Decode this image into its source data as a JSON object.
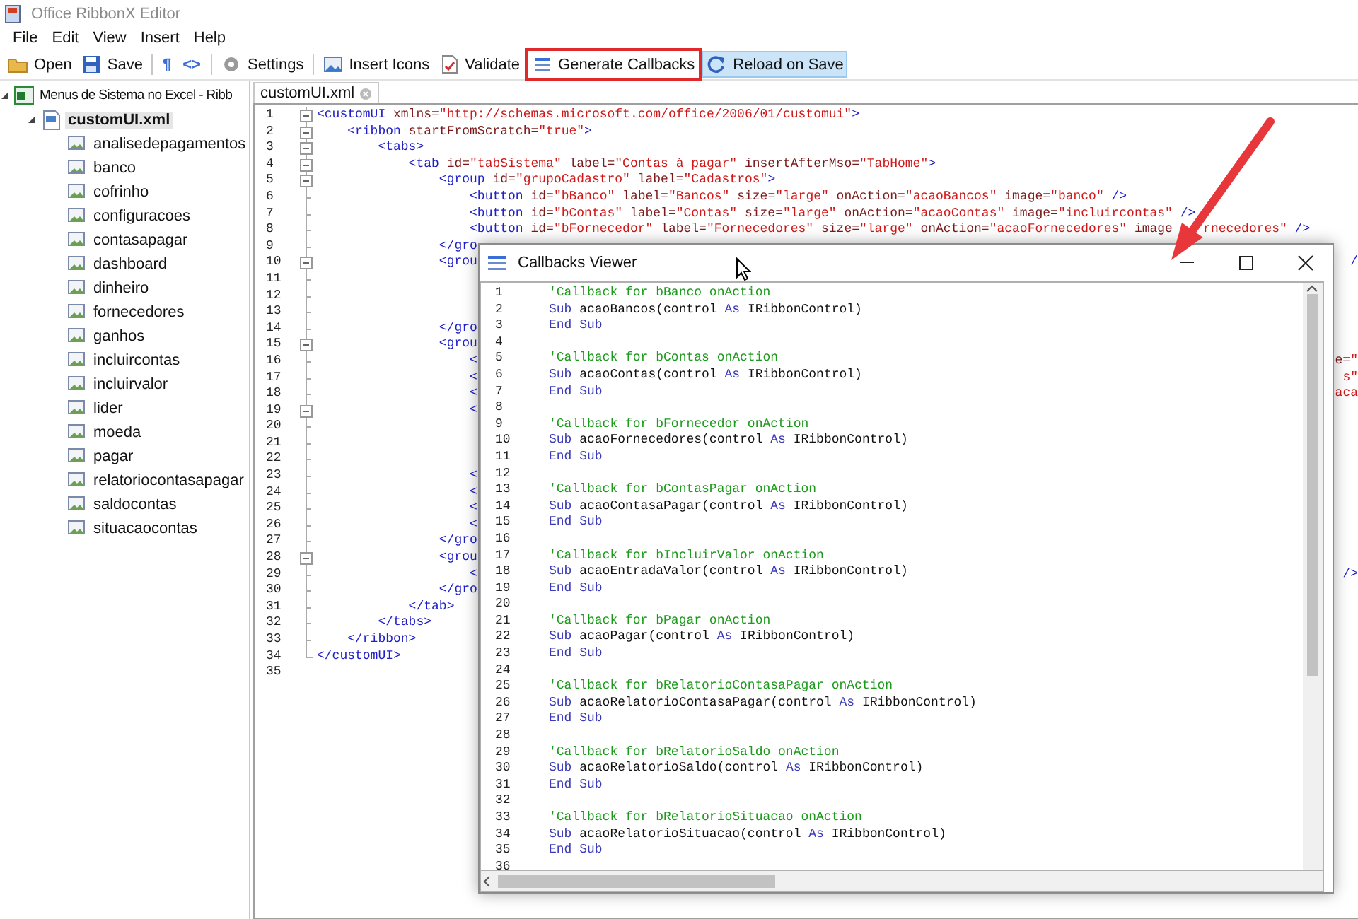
{
  "window": {
    "title": "Office RibbonX Editor"
  },
  "menu": [
    "File",
    "Edit",
    "View",
    "Insert",
    "Help"
  ],
  "toolbar": [
    {
      "kind": "button",
      "label": "Open",
      "checked": false,
      "highlighted": false
    },
    {
      "kind": "button",
      "label": "Save",
      "checked": false,
      "highlighted": false
    },
    {
      "kind": "separator"
    },
    {
      "kind": "glyph",
      "label": "¶"
    },
    {
      "kind": "glyph",
      "label": "<>"
    },
    {
      "kind": "separator"
    },
    {
      "kind": "button",
      "label": "Settings",
      "checked": false,
      "highlighted": false
    },
    {
      "kind": "separator"
    },
    {
      "kind": "button",
      "label": "Insert Icons",
      "checked": false,
      "highlighted": false
    },
    {
      "kind": "button",
      "label": "Validate",
      "checked": false,
      "highlighted": false
    },
    {
      "kind": "button",
      "label": "Generate Callbacks",
      "checked": false,
      "highlighted": true
    },
    {
      "kind": "button",
      "label": "Reload on Save",
      "checked": true,
      "highlighted": false
    }
  ],
  "tree": [
    {
      "label": "Menus de Sistema no Excel - Ribb",
      "expanded": true,
      "selected": false,
      "children": [
        {
          "label": "customUI.xml",
          "expanded": true,
          "selected": true,
          "children": [
            {
              "label": "analisedepagamentos",
              "selected": false
            },
            {
              "label": "banco",
              "selected": false
            },
            {
              "label": "cofrinho",
              "selected": false
            },
            {
              "label": "configuracoes",
              "selected": false
            },
            {
              "label": "contasapagar",
              "selected": false
            },
            {
              "label": "dashboard",
              "selected": false
            },
            {
              "label": "dinheiro",
              "selected": false
            },
            {
              "label": "fornecedores",
              "selected": false
            },
            {
              "label": "ganhos",
              "selected": false
            },
            {
              "label": "incluircontas",
              "selected": false
            },
            {
              "label": "incluirvalor",
              "selected": false
            },
            {
              "label": "lider",
              "selected": false
            },
            {
              "label": "moeda",
              "selected": false
            },
            {
              "label": "pagar",
              "selected": false
            },
            {
              "label": "relatoriocontasapagar",
              "selected": false
            },
            {
              "label": "saldocontas",
              "selected": false
            },
            {
              "label": "situacaocontas",
              "selected": false
            }
          ]
        }
      ]
    }
  ],
  "editor": {
    "tab": {
      "label": "customUI.xml",
      "selected": true
    },
    "lines": [
      {
        "number": "1",
        "kind": "toggle",
        "tokens": [
          {
            "kind": "tag",
            "text": "<customUI"
          },
          {
            "kind": "attr",
            "text": " xmlns="
          },
          {
            "kind": "value",
            "text": "\"http://schemas.microsoft.com/office/2006/01/customui\""
          },
          {
            "kind": "tag",
            "text": ">"
          }
        ]
      },
      {
        "number": "2",
        "kind": "toggle",
        "tokens": [
          {
            "kind": "tag",
            "text": "    <ribbon"
          },
          {
            "kind": "attr",
            "text": " startFromScratch="
          },
          {
            "kind": "value",
            "text": "\"true\""
          },
          {
            "kind": "tag",
            "text": ">"
          }
        ]
      },
      {
        "number": "3",
        "kind": "toggle",
        "tokens": [
          {
            "kind": "tag",
            "text": "        <tabs>"
          }
        ]
      },
      {
        "number": "4",
        "kind": "toggle",
        "tokens": [
          {
            "kind": "tag",
            "text": "            <tab"
          },
          {
            "kind": "attr",
            "text": " id="
          },
          {
            "kind": "value",
            "text": "\"tabSistema\""
          },
          {
            "kind": "attr",
            "text": " label="
          },
          {
            "kind": "value",
            "text": "\"Contas à pagar\""
          },
          {
            "kind": "attr",
            "text": " insertAfterMso="
          },
          {
            "kind": "value",
            "text": "\"TabHome\""
          },
          {
            "kind": "tag",
            "text": ">"
          }
        ]
      },
      {
        "number": "5",
        "kind": "toggle",
        "tokens": [
          {
            "kind": "tag",
            "text": "                <group"
          },
          {
            "kind": "attr",
            "text": " id="
          },
          {
            "kind": "value",
            "text": "\"grupoCadastro\""
          },
          {
            "kind": "attr",
            "text": " label="
          },
          {
            "kind": "value",
            "text": "\"Cadastros\""
          },
          {
            "kind": "tag",
            "text": ">"
          }
        ]
      },
      {
        "number": "6",
        "kind": "line",
        "tokens": [
          {
            "kind": "tag",
            "text": "                    <button"
          },
          {
            "kind": "attr",
            "text": " id="
          },
          {
            "kind": "value",
            "text": "\"bBanco\""
          },
          {
            "kind": "attr",
            "text": " label="
          },
          {
            "kind": "value",
            "text": "\"Bancos\""
          },
          {
            "kind": "attr",
            "text": " size="
          },
          {
            "kind": "value",
            "text": "\"large\""
          },
          {
            "kind": "attr",
            "text": " onAction="
          },
          {
            "kind": "value",
            "text": "\"acaoBancos\""
          },
          {
            "kind": "attr",
            "text": " image="
          },
          {
            "kind": "value",
            "text": "\"banco\""
          },
          {
            "kind": "tag",
            "text": " />"
          }
        ]
      },
      {
        "number": "7",
        "kind": "line",
        "tokens": [
          {
            "kind": "tag",
            "text": "                    <button"
          },
          {
            "kind": "attr",
            "text": " id="
          },
          {
            "kind": "value",
            "text": "\"bContas\""
          },
          {
            "kind": "attr",
            "text": " label="
          },
          {
            "kind": "value",
            "text": "\"Contas\""
          },
          {
            "kind": "attr",
            "text": " size="
          },
          {
            "kind": "value",
            "text": "\"large\""
          },
          {
            "kind": "attr",
            "text": " onAction="
          },
          {
            "kind": "value",
            "text": "\"acaoContas\""
          },
          {
            "kind": "attr",
            "text": " image="
          },
          {
            "kind": "value",
            "text": "\"incluircontas\""
          },
          {
            "kind": "tag",
            "text": " />"
          }
        ]
      },
      {
        "number": "8",
        "kind": "line",
        "tokens": [
          {
            "kind": "tag",
            "text": "                    <button"
          },
          {
            "kind": "attr",
            "text": " id="
          },
          {
            "kind": "value",
            "text": "\"bFornecedor\""
          },
          {
            "kind": "attr",
            "text": " label="
          },
          {
            "kind": "value",
            "text": "\"Fornecedores\""
          },
          {
            "kind": "attr",
            "text": " size="
          },
          {
            "kind": "value",
            "text": "\"large\""
          },
          {
            "kind": "attr",
            "text": " onAction="
          },
          {
            "kind": "value",
            "text": "\"acaoFornecedores\""
          },
          {
            "kind": "attr",
            "text": " image"
          }
        ],
        "after_arrow": [
          {
            "kind": "value",
            "text": "rnecedores\""
          },
          {
            "kind": "tag",
            "text": " />"
          }
        ]
      },
      {
        "number": "9",
        "kind": "line",
        "tokens": [
          {
            "kind": "tag",
            "text": "                </gro"
          }
        ]
      },
      {
        "number": "10",
        "kind": "toggle",
        "tokens": [
          {
            "kind": "tag",
            "text": "                <grou"
          }
        ],
        "tail": [
          {
            "kind": "tag",
            "text": "/"
          }
        ]
      },
      {
        "number": "11",
        "kind": "line"
      },
      {
        "number": "12",
        "kind": "line"
      },
      {
        "number": "13",
        "kind": "line"
      },
      {
        "number": "14",
        "kind": "line",
        "tokens": [
          {
            "kind": "tag",
            "text": "                </gro"
          }
        ]
      },
      {
        "number": "15",
        "kind": "toggle",
        "tokens": [
          {
            "kind": "tag",
            "text": "                <grou"
          }
        ]
      },
      {
        "number": "16",
        "kind": "line",
        "tokens": [
          {
            "kind": "tag",
            "text": "                    <"
          }
        ],
        "tail": [
          {
            "kind": "attr",
            "text": "e="
          },
          {
            "kind": "value",
            "text": "\""
          }
        ]
      },
      {
        "number": "17",
        "kind": "line",
        "tokens": [
          {
            "kind": "tag",
            "text": "                    <"
          }
        ],
        "tail": [
          {
            "kind": "value",
            "text": "s\""
          }
        ]
      },
      {
        "number": "18",
        "kind": "line",
        "tokens": [
          {
            "kind": "tag",
            "text": "                    <"
          }
        ],
        "tail": [
          {
            "kind": "value",
            "text": "aca"
          }
        ]
      },
      {
        "number": "19",
        "kind": "toggle",
        "tokens": [
          {
            "kind": "tag",
            "text": "                    <"
          }
        ]
      },
      {
        "number": "20",
        "kind": "line"
      },
      {
        "number": "21",
        "kind": "line"
      },
      {
        "number": "22",
        "kind": "line"
      },
      {
        "number": "23",
        "kind": "line",
        "tokens": [
          {
            "kind": "tag",
            "text": "                    <"
          }
        ]
      },
      {
        "number": "24",
        "kind": "line",
        "tokens": [
          {
            "kind": "tag",
            "text": "                    <"
          }
        ]
      },
      {
        "number": "25",
        "kind": "line",
        "tokens": [
          {
            "kind": "tag",
            "text": "                    <"
          }
        ]
      },
      {
        "number": "26",
        "kind": "line",
        "tokens": [
          {
            "kind": "tag",
            "text": "                    <"
          }
        ]
      },
      {
        "number": "27",
        "kind": "line",
        "tokens": [
          {
            "kind": "tag",
            "text": "                </gro"
          }
        ]
      },
      {
        "number": "28",
        "kind": "toggle",
        "tokens": [
          {
            "kind": "tag",
            "text": "                <grou"
          }
        ]
      },
      {
        "number": "29",
        "kind": "line",
        "tokens": [
          {
            "kind": "tag",
            "text": "                    <"
          }
        ],
        "tail": [
          {
            "kind": "tag",
            "text": "/>"
          }
        ]
      },
      {
        "number": "30",
        "kind": "line",
        "tokens": [
          {
            "kind": "tag",
            "text": "                </gro"
          }
        ]
      },
      {
        "number": "31",
        "kind": "line",
        "tokens": [
          {
            "kind": "tag",
            "text": "            </tab>"
          }
        ]
      },
      {
        "number": "32",
        "kind": "line",
        "tokens": [
          {
            "kind": "tag",
            "text": "        </tabs>"
          }
        ]
      },
      {
        "number": "33",
        "kind": "line",
        "tokens": [
          {
            "kind": "tag",
            "text": "    </ribbon>"
          }
        ]
      },
      {
        "number": "34",
        "kind": "end",
        "tokens": [
          {
            "kind": "tag",
            "text": "</customUI>"
          }
        ]
      },
      {
        "number": "35"
      }
    ]
  },
  "callbacks_viewer": {
    "title": "Callbacks Viewer",
    "lines": [
      {
        "number": "1",
        "tokens": [
          {
            "kind": "comment",
            "text": "'Callback for bBanco onAction"
          }
        ]
      },
      {
        "number": "2",
        "tokens": [
          {
            "kind": "keyword",
            "text": "Sub"
          },
          {
            "kind": "plain",
            "text": " acaoBancos(control "
          },
          {
            "kind": "keyword",
            "text": "As"
          },
          {
            "kind": "plain",
            "text": " IRibbonControl)"
          }
        ]
      },
      {
        "number": "3",
        "tokens": [
          {
            "kind": "keyword",
            "text": "End Sub"
          }
        ]
      },
      {
        "number": "4"
      },
      {
        "number": "5",
        "tokens": [
          {
            "kind": "comment",
            "text": "'Callback for bContas onAction"
          }
        ]
      },
      {
        "number": "6",
        "tokens": [
          {
            "kind": "keyword",
            "text": "Sub"
          },
          {
            "kind": "plain",
            "text": " acaoContas(control "
          },
          {
            "kind": "keyword",
            "text": "As"
          },
          {
            "kind": "plain",
            "text": " IRibbonControl)"
          }
        ]
      },
      {
        "number": "7",
        "tokens": [
          {
            "kind": "keyword",
            "text": "End Sub"
          }
        ]
      },
      {
        "number": "8"
      },
      {
        "number": "9",
        "tokens": [
          {
            "kind": "comment",
            "text": "'Callback for bFornecedor onAction"
          }
        ]
      },
      {
        "number": "10",
        "tokens": [
          {
            "kind": "keyword",
            "text": "Sub"
          },
          {
            "kind": "plain",
            "text": " acaoFornecedores(control "
          },
          {
            "kind": "keyword",
            "text": "As"
          },
          {
            "kind": "plain",
            "text": " IRibbonControl)"
          }
        ]
      },
      {
        "number": "11",
        "tokens": [
          {
            "kind": "keyword",
            "text": "End Sub"
          }
        ]
      },
      {
        "number": "12"
      },
      {
        "number": "13",
        "tokens": [
          {
            "kind": "comment",
            "text": "'Callback for bContasPagar onAction"
          }
        ]
      },
      {
        "number": "14",
        "tokens": [
          {
            "kind": "keyword",
            "text": "Sub"
          },
          {
            "kind": "plain",
            "text": " acaoContasaPagar(control "
          },
          {
            "kind": "keyword",
            "text": "As"
          },
          {
            "kind": "plain",
            "text": " IRibbonControl)"
          }
        ]
      },
      {
        "number": "15",
        "tokens": [
          {
            "kind": "keyword",
            "text": "End Sub"
          }
        ]
      },
      {
        "number": "16"
      },
      {
        "number": "17",
        "tokens": [
          {
            "kind": "comment",
            "text": "'Callback for bIncluirValor onAction"
          }
        ]
      },
      {
        "number": "18",
        "tokens": [
          {
            "kind": "keyword",
            "text": "Sub"
          },
          {
            "kind": "plain",
            "text": " acaoEntradaValor(control "
          },
          {
            "kind": "keyword",
            "text": "As"
          },
          {
            "kind": "plain",
            "text": " IRibbonControl)"
          }
        ]
      },
      {
        "number": "19",
        "tokens": [
          {
            "kind": "keyword",
            "text": "End Sub"
          }
        ]
      },
      {
        "number": "20"
      },
      {
        "number": "21",
        "tokens": [
          {
            "kind": "comment",
            "text": "'Callback for bPagar onAction"
          }
        ]
      },
      {
        "number": "22",
        "tokens": [
          {
            "kind": "keyword",
            "text": "Sub"
          },
          {
            "kind": "plain",
            "text": " acaoPagar(control "
          },
          {
            "kind": "keyword",
            "text": "As"
          },
          {
            "kind": "plain",
            "text": " IRibbonControl)"
          }
        ]
      },
      {
        "number": "23",
        "tokens": [
          {
            "kind": "keyword",
            "text": "End Sub"
          }
        ]
      },
      {
        "number": "24"
      },
      {
        "number": "25",
        "tokens": [
          {
            "kind": "comment",
            "text": "'Callback for bRelatorioContasaPagar onAction"
          }
        ]
      },
      {
        "number": "26",
        "tokens": [
          {
            "kind": "keyword",
            "text": "Sub"
          },
          {
            "kind": "plain",
            "text": " acaoRelatorioContasaPagar(control "
          },
          {
            "kind": "keyword",
            "text": "As"
          },
          {
            "kind": "plain",
            "text": " IRibbonControl)"
          }
        ]
      },
      {
        "number": "27",
        "tokens": [
          {
            "kind": "keyword",
            "text": "End Sub"
          }
        ]
      },
      {
        "number": "28"
      },
      {
        "number": "29",
        "tokens": [
          {
            "kind": "comment",
            "text": "'Callback for bRelatorioSaldo onAction"
          }
        ]
      },
      {
        "number": "30",
        "tokens": [
          {
            "kind": "keyword",
            "text": "Sub"
          },
          {
            "kind": "plain",
            "text": " acaoRelatorioSaldo(control "
          },
          {
            "kind": "keyword",
            "text": "As"
          },
          {
            "kind": "plain",
            "text": " IRibbonControl)"
          }
        ]
      },
      {
        "number": "31",
        "tokens": [
          {
            "kind": "keyword",
            "text": "End Sub"
          }
        ]
      },
      {
        "number": "32"
      },
      {
        "number": "33",
        "tokens": [
          {
            "kind": "comment",
            "text": "'Callback for bRelatorioSituacao onAction"
          }
        ]
      },
      {
        "number": "34",
        "tokens": [
          {
            "kind": "keyword",
            "text": "Sub"
          },
          {
            "kind": "plain",
            "text": " acaoRelatorioSituacao(control "
          },
          {
            "kind": "keyword",
            "text": "As"
          },
          {
            "kind": "plain",
            "text": " IRibbonControl)"
          }
        ]
      },
      {
        "number": "35",
        "tokens": [
          {
            "kind": "keyword",
            "text": "End Sub"
          }
        ]
      },
      {
        "number": "36"
      }
    ]
  }
}
